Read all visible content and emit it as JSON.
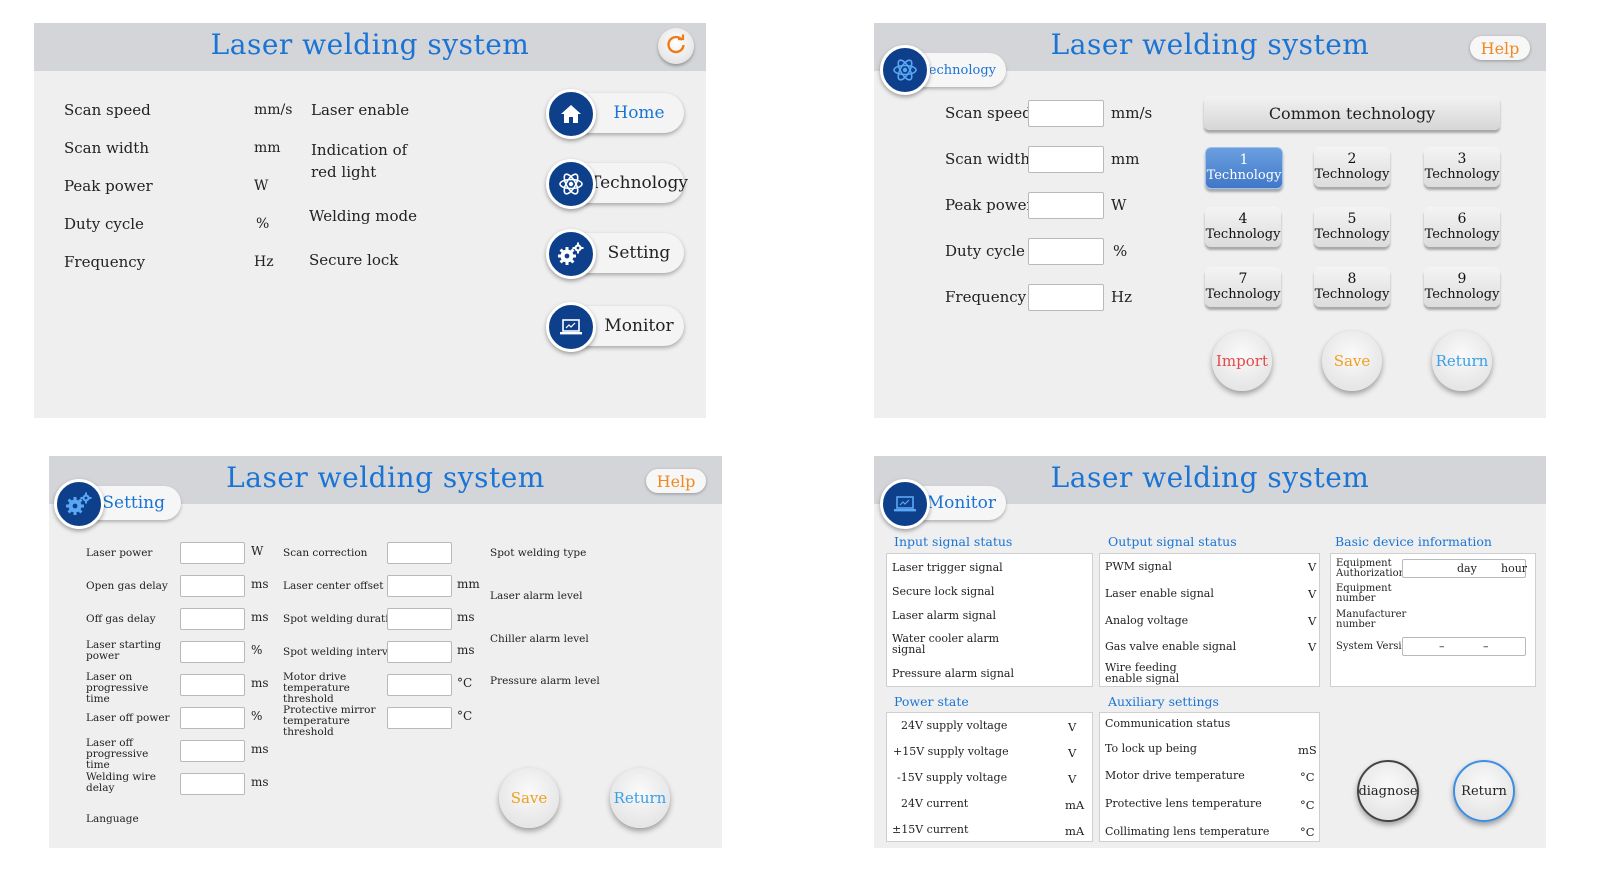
{
  "app_title": "Laser welding system",
  "home": {
    "params": [
      {
        "label": "Scan speed",
        "unit": "mm/s"
      },
      {
        "label": "Scan width",
        "unit": "mm"
      },
      {
        "label": "Peak power",
        "unit": "W"
      },
      {
        "label": "Duty cycle",
        "unit": "%"
      },
      {
        "label": "Frequency",
        "unit": "Hz"
      }
    ],
    "status": [
      "Laser enable",
      "Indication of",
      "red light",
      "Welding mode",
      "Secure lock"
    ],
    "nav": [
      "Home",
      "Technology",
      "Setting",
      "Monitor"
    ]
  },
  "technology": {
    "tab": "Technology",
    "help": "Help",
    "params": [
      {
        "label": "Scan speed",
        "unit": "mm/s"
      },
      {
        "label": "Scan width",
        "unit": "mm"
      },
      {
        "label": "Peak power",
        "unit": "W"
      },
      {
        "label": "Duty cycle",
        "unit": "%"
      },
      {
        "label": "Frequency",
        "unit": "Hz"
      }
    ],
    "common": "Common technology",
    "tile_word": "Technology",
    "tiles": [
      "1",
      "2",
      "3",
      "4",
      "5",
      "6",
      "7",
      "8",
      "9"
    ],
    "buttons": {
      "import": "Import",
      "save": "Save",
      "return": "Return"
    },
    "colors": {
      "import": "#e44a4a",
      "save": "#f0a020",
      "return": "#3aa0ea"
    }
  },
  "setting": {
    "tab": "Setting",
    "help": "Help",
    "col1": [
      {
        "label": "Laser power",
        "unit": "W"
      },
      {
        "label": "Open gas delay",
        "unit": "ms"
      },
      {
        "label": "Off gas delay",
        "unit": "ms"
      },
      {
        "label": "Laser starting power",
        "unit": "%"
      },
      {
        "label": "Laser on progressive time",
        "unit": "ms"
      },
      {
        "label": "Laser off power",
        "unit": "%"
      },
      {
        "label": "Laser off progressive time",
        "unit": "ms"
      },
      {
        "label": "Welding wire delay",
        "unit": "ms"
      }
    ],
    "language": "Language",
    "col2": [
      {
        "label": "Scan correction",
        "unit": ""
      },
      {
        "label": "Laser center offset",
        "unit": "mm"
      },
      {
        "label": "Spot welding duration",
        "unit": "ms"
      },
      {
        "label": "Spot welding interval",
        "unit": "ms"
      },
      {
        "label": "Motor drive temperature threshold",
        "unit": "°C"
      },
      {
        "label": "Protective mirror temperature threshold",
        "unit": "°C"
      }
    ],
    "col3": [
      "Spot welding type",
      "Laser alarm level",
      "Chiller alarm level",
      "Pressure alarm level"
    ],
    "buttons": {
      "save": "Save",
      "return": "Return"
    }
  },
  "monitor": {
    "tab": "Monitor",
    "input_title": "Input signal status",
    "inputs": [
      "Laser trigger signal",
      "Secure lock signal",
      "Laser alarm signal",
      "Water cooler alarm signal",
      "Pressure alarm signal"
    ],
    "output_title": "Output signal status",
    "outputs": [
      {
        "label": "PWM signal",
        "unit": "V"
      },
      {
        "label": "Laser enable signal",
        "unit": "V"
      },
      {
        "label": "Analog voltage",
        "unit": "V"
      },
      {
        "label": "Gas valve enable signal",
        "unit": "V"
      },
      {
        "label": "Wire feeding enable signal",
        "unit": ""
      }
    ],
    "basic_title": "Basic device information",
    "basic": {
      "auth": "Equipment Authorization",
      "day": "day",
      "hour": "hour",
      "equip_no": "Equipment number",
      "manuf_no": "Manufacturer number",
      "version": "System Version",
      "dash": "–"
    },
    "power_title": "Power state",
    "power": [
      {
        "label": "24V supply voltage",
        "unit": "V"
      },
      {
        "label": "+15V supply voltage",
        "unit": "V"
      },
      {
        "label": "-15V supply voltage",
        "unit": "V"
      },
      {
        "label": "24V current",
        "unit": "mA"
      },
      {
        "label": "±15V current",
        "unit": "mA"
      }
    ],
    "aux_title": "Auxiliary settings",
    "aux": [
      {
        "label": "Communication status",
        "unit": ""
      },
      {
        "label": "To lock up being",
        "unit": "mS"
      },
      {
        "label": "Motor drive temperature",
        "unit": "°C"
      },
      {
        "label": "Protective lens temperature",
        "unit": "°C"
      },
      {
        "label": "Collimating lens temperature",
        "unit": "°C"
      }
    ],
    "buttons": {
      "diagnose": "diagnose",
      "return": "Return"
    }
  }
}
